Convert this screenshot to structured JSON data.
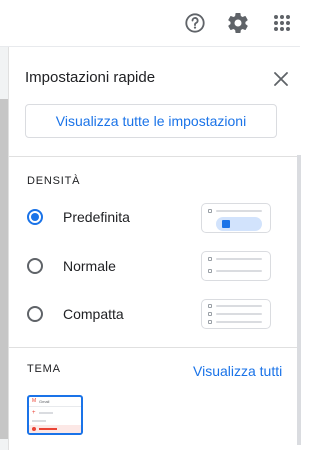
{
  "topbar": {
    "icons": [
      "help-icon",
      "gear-icon",
      "apps-grid-icon"
    ]
  },
  "panel": {
    "title": "Impostazioni rapide",
    "close_icon": "close-icon",
    "view_all_button": "Visualizza tutte le impostazioni",
    "density": {
      "heading": "DENSITÀ",
      "options": [
        {
          "label": "Predefinita",
          "selected": true
        },
        {
          "label": "Normale",
          "selected": false
        },
        {
          "label": "Compatta",
          "selected": false
        }
      ]
    },
    "theme": {
      "heading": "TEMA",
      "link": "Visualizza tutti",
      "thumbnail_label": "Gmail"
    }
  },
  "colors": {
    "accent": "#1a73e8",
    "text": "#202124",
    "border": "#dadce0"
  }
}
